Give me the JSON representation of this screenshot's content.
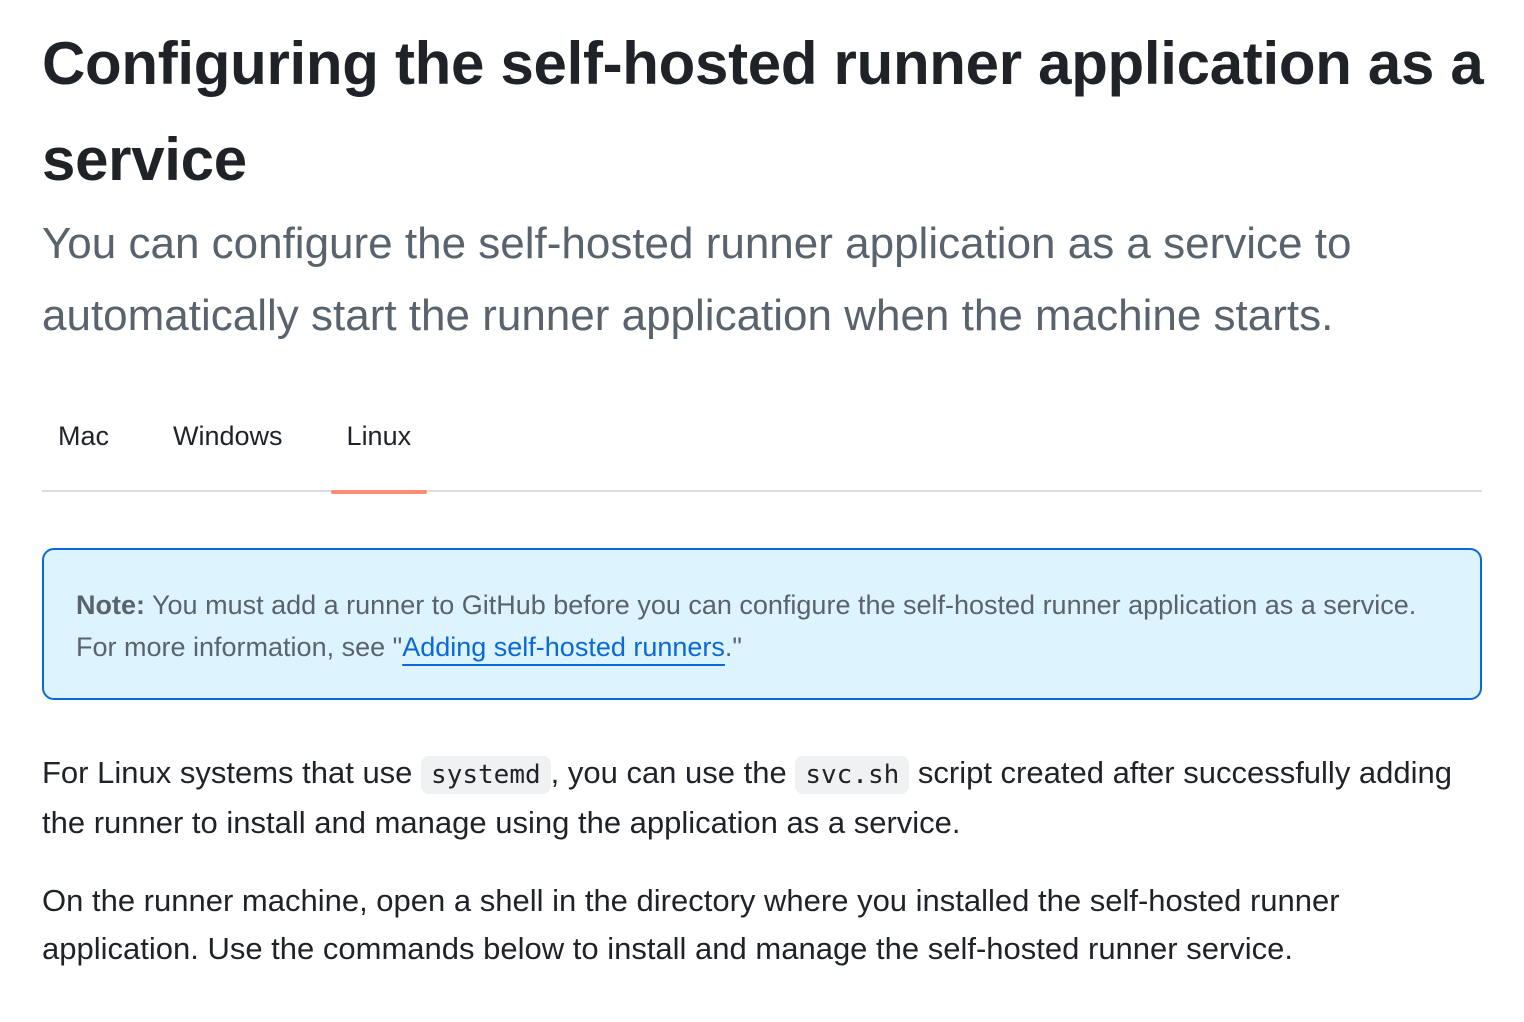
{
  "article": {
    "title": "Configuring the self-hosted runner application as a service",
    "intro": "You can configure the self-hosted runner application as a service to automatically start the runner application when the machine starts."
  },
  "tabs": [
    {
      "label": "Mac",
      "active": false
    },
    {
      "label": "Windows",
      "active": false
    },
    {
      "label": "Linux",
      "active": true
    }
  ],
  "note": {
    "label": "Note:",
    "text_before": " You must add a runner to GitHub before you can configure the self-hosted runner application as a service. For more information, see \"",
    "link_text": "Adding self-hosted runners",
    "text_after": ".\""
  },
  "paragraph_1": {
    "part_1": "For Linux systems that use ",
    "code_1": "systemd",
    "part_2": ", you can use the ",
    "code_2": "svc.sh",
    "part_3": " script created after successfully adding the runner to install and manage using the application as a service."
  },
  "paragraph_2": {
    "text": "On the runner machine, open a shell in the directory where you installed the self-hosted runner application. Use the commands below to install and manage the self-hosted runner service."
  },
  "colors": {
    "tab_underline": "#fd8c73",
    "note_background": "#ddf4ff",
    "note_border": "#0969da",
    "link": "#0969da",
    "muted_text": "#59636e",
    "code_background": "#eff1f3"
  }
}
